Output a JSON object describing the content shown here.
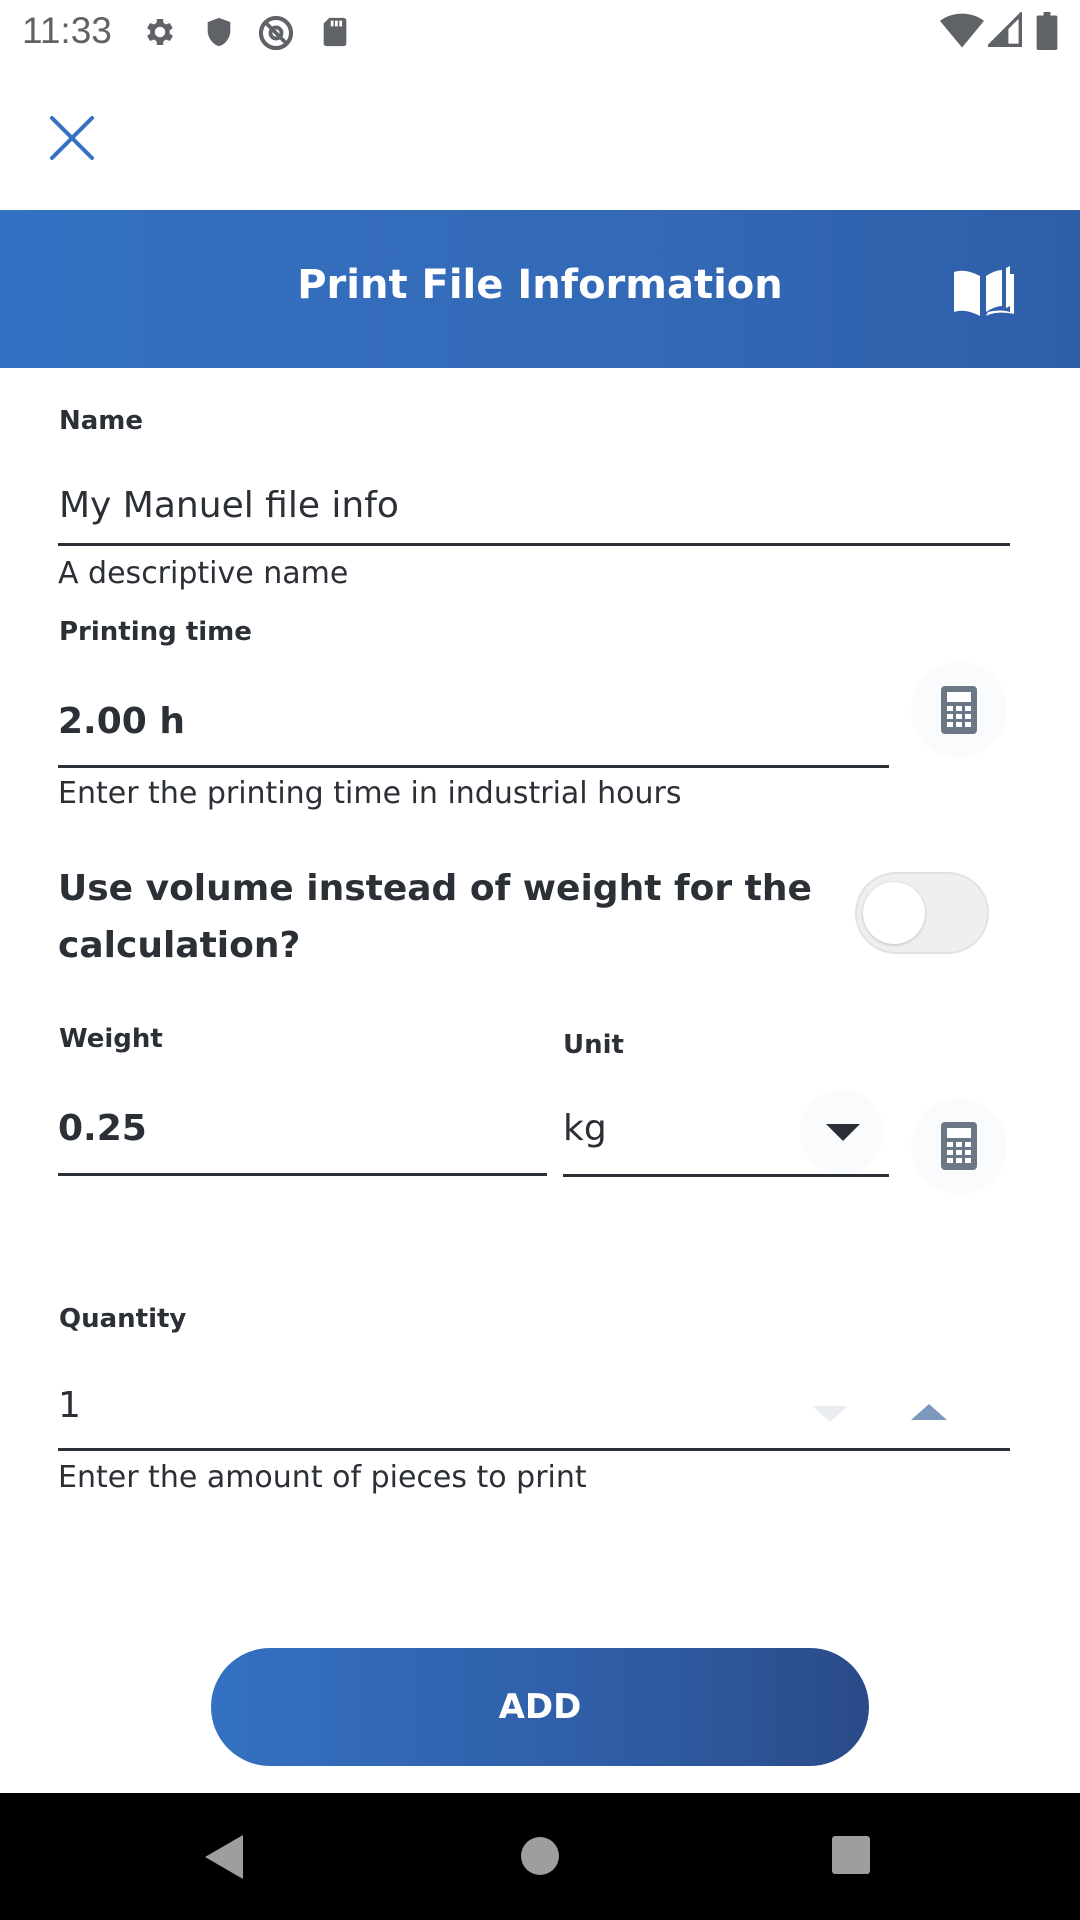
{
  "status_bar": {
    "time": "11:33",
    "left_icons": [
      "gear-icon",
      "shield-icon",
      "at-sign-icon",
      "sd-card-icon"
    ],
    "right_icons": [
      "wifi-icon",
      "signal-icon",
      "battery-icon"
    ]
  },
  "top": {
    "close_icon": "close-icon"
  },
  "header": {
    "title": "Print File Information",
    "manual_icon": "book-icon",
    "color": "#3369b6"
  },
  "form": {
    "name": {
      "label": "Name",
      "value": "My Manuel file info",
      "helper": "A descriptive name"
    },
    "printing_time": {
      "label": "Printing time",
      "value": "2.00 h",
      "helper": "Enter the printing time in industrial hours",
      "calculator_icon": "calculator-icon"
    },
    "volume_toggle": {
      "label": "Use volume instead of weight for the calculation?",
      "checked": false
    },
    "weight": {
      "label": "Weight",
      "value": "0.25",
      "calculator_icon": "calculator-icon"
    },
    "unit": {
      "label": "Unit",
      "selected": "kg"
    },
    "quantity": {
      "label": "Quantity",
      "value": "1",
      "helper": "Enter the amount of pieces to print"
    }
  },
  "actions": {
    "add_label": "ADD",
    "accent_color": "#3471c2"
  },
  "nav_bar": {
    "icons": [
      "back-icon",
      "home-icon",
      "recents-icon"
    ]
  }
}
